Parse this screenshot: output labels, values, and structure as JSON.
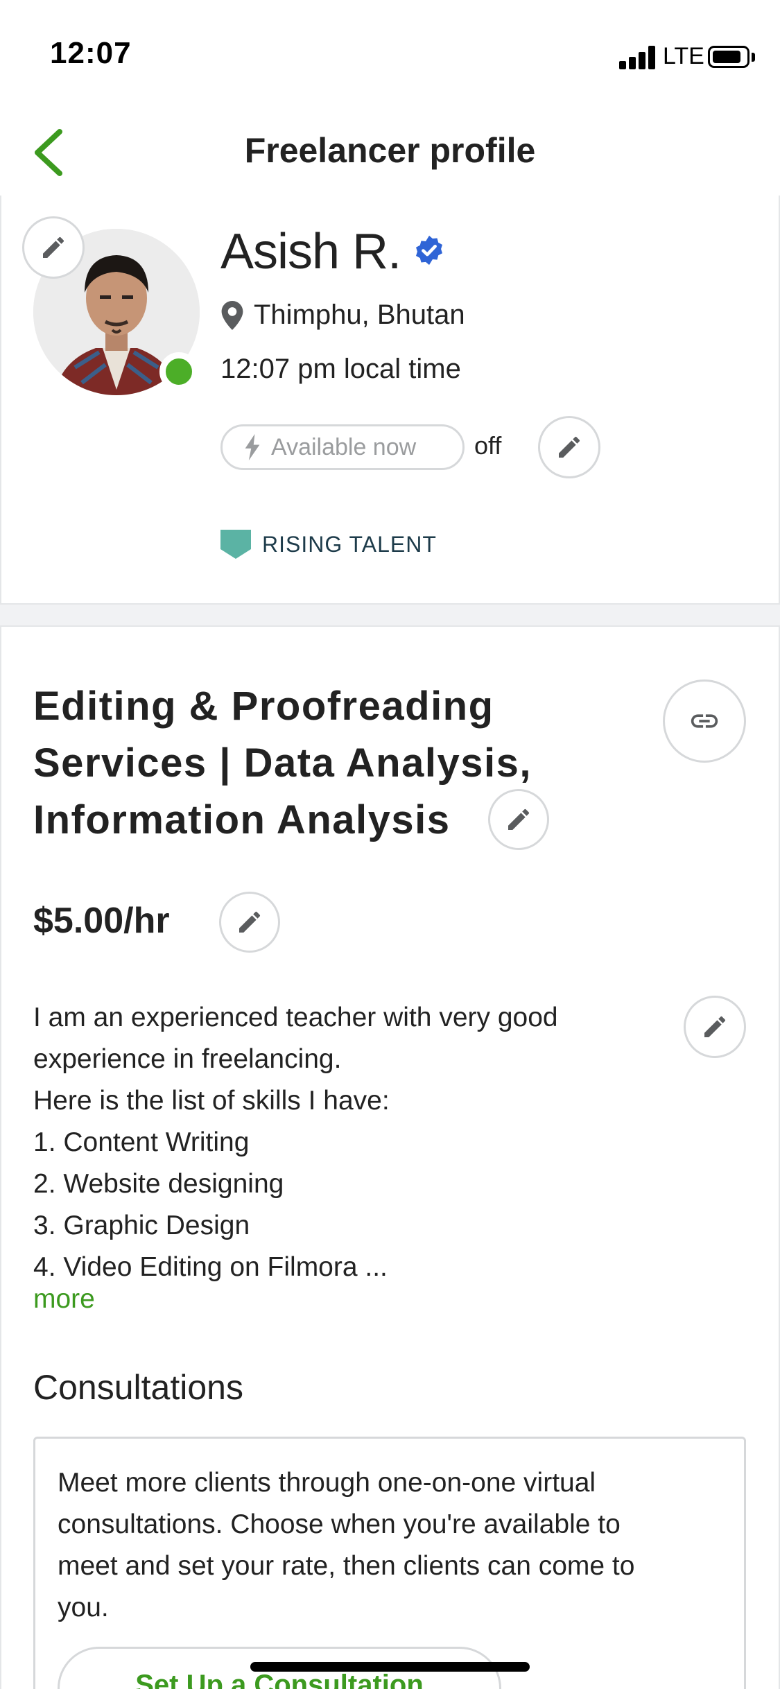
{
  "status_bar": {
    "time": "12:07",
    "network": "LTE"
  },
  "nav": {
    "title": "Freelancer profile"
  },
  "profile": {
    "name": "Asish R.",
    "location": "Thimphu, Bhutan",
    "local_time": "12:07 pm local time",
    "availability_label": "Available now",
    "availability_state": "off",
    "badge": "RISING TALENT"
  },
  "listing": {
    "headline_lines": [
      "Editing & Proofreading",
      "Services | Data Analysis,",
      "Information Analysis"
    ],
    "rate": "$5.00/hr",
    "overview_lines": [
      "I am an experienced teacher with very good",
      "experience in freelancing.",
      "Here is the list of skills I have:",
      "1. Content Writing",
      "2. Website designing",
      "3. Graphic Design",
      "4. Video Editing on Filmora ..."
    ],
    "more_label": "more"
  },
  "consultations": {
    "title": "Consultations",
    "description_lines": [
      "Meet more clients through one-on-one virtual",
      "consultations. Choose when you're available to",
      "meet and set your rate, then clients can come to",
      "you."
    ],
    "button_label": "Set Up a Consultation"
  },
  "colors": {
    "accent_green": "#3c9a1f",
    "online_green": "#4cae28",
    "verified_blue": "#2f64d6",
    "badge_teal": "#5bb3a4"
  }
}
